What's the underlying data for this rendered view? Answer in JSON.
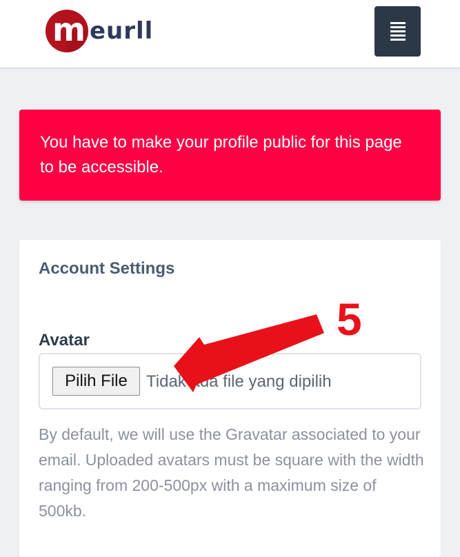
{
  "header": {
    "logo_text": "eurll",
    "logo_mark_letter": "m",
    "menu_icon": "hamburger-menu-icon"
  },
  "alert": {
    "message": "You have to make your profile public for this page to be accessible.",
    "color": "#ff0044"
  },
  "account_settings": {
    "title": "Account Settings",
    "avatar": {
      "label": "Avatar",
      "choose_file_button": "Pilih File",
      "file_status": "Tidak ada file yang dipilih",
      "help_text": "By default, we will use the Gravatar associated to your email. Uploaded avatars must be square with the width ranging from 200-500px with a maximum size of 500kb."
    }
  },
  "annotation": {
    "number": "5",
    "color": "#e8111a"
  },
  "colors": {
    "background": "#eef0f3",
    "menu_button": "#2c3846",
    "brand_red": "#b3121f",
    "brand_navy": "#2f3a5b"
  }
}
